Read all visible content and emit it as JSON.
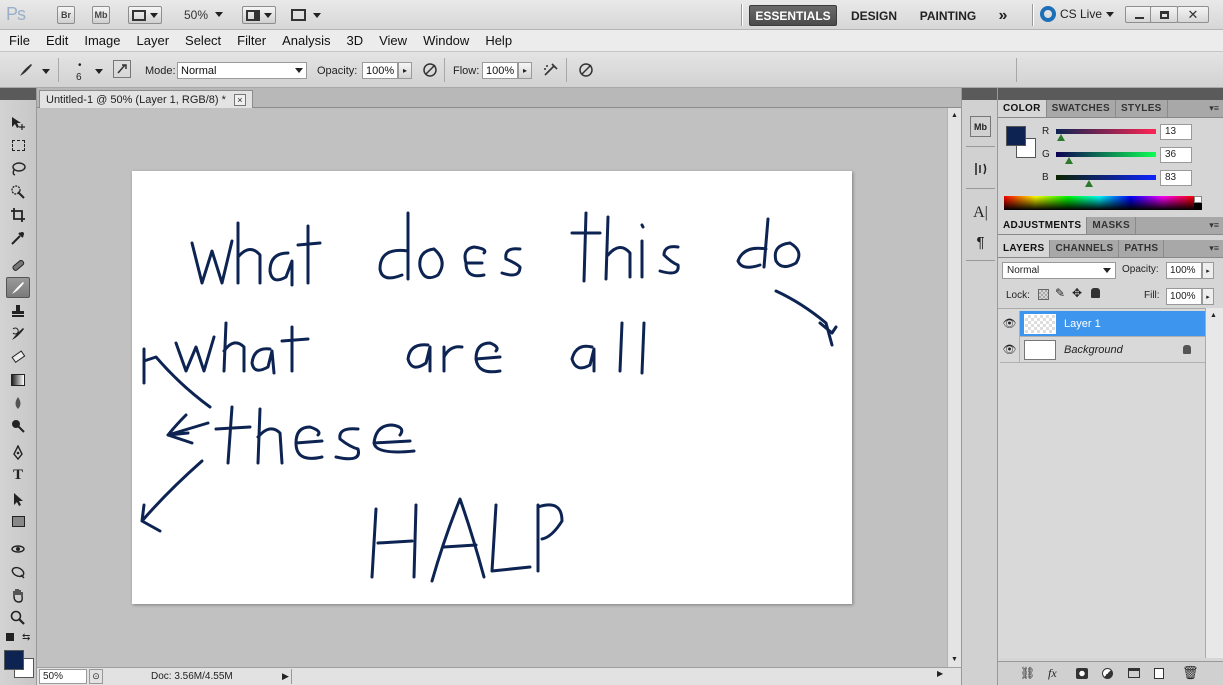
{
  "appbar": {
    "logo": "Ps",
    "bridge_label": "Br",
    "minibridge_label": "Mb",
    "zoom": "50%",
    "workspaces": [
      "ESSENTIALS",
      "DESIGN",
      "PAINTING"
    ],
    "more": "»",
    "cslive": "CS Live"
  },
  "menu": [
    "File",
    "Edit",
    "Image",
    "Layer",
    "Select",
    "Filter",
    "Analysis",
    "3D",
    "View",
    "Window",
    "Help"
  ],
  "options": {
    "brush_size": "6",
    "mode_label": "Mode:",
    "mode_value": "Normal",
    "opacity_label": "Opacity:",
    "opacity_value": "100%",
    "flow_label": "Flow:",
    "flow_value": "100%"
  },
  "document": {
    "tab_title": "Untitled-1 @ 50% (Layer 1, RGB/8) *",
    "close": "×",
    "ink_color": "#0d2453"
  },
  "status": {
    "zoom": "50%",
    "doc_info": "Doc: 3.56M/4.55M"
  },
  "color_panel": {
    "tabs": [
      "COLOR",
      "SWATCHES",
      "STYLES"
    ],
    "channels": [
      {
        "label": "R",
        "value": "13"
      },
      {
        "label": "G",
        "value": "36"
      },
      {
        "label": "B",
        "value": "83"
      }
    ],
    "foreground": "#0d2453",
    "background": "#ffffff"
  },
  "adjustments_panel": {
    "tabs": [
      "ADJUSTMENTS",
      "MASKS"
    ]
  },
  "layers_panel": {
    "tabs": [
      "LAYERS",
      "CHANNELS",
      "PATHS"
    ],
    "blend_mode": "Normal",
    "opacity_label": "Opacity:",
    "opacity_value": "100%",
    "lock_label": "Lock:",
    "fill_label": "Fill:",
    "fill_value": "100%",
    "layers": [
      {
        "name": "Layer 1",
        "selected": true
      },
      {
        "name": "Background",
        "selected": false
      }
    ],
    "footer_fx": "fx"
  }
}
